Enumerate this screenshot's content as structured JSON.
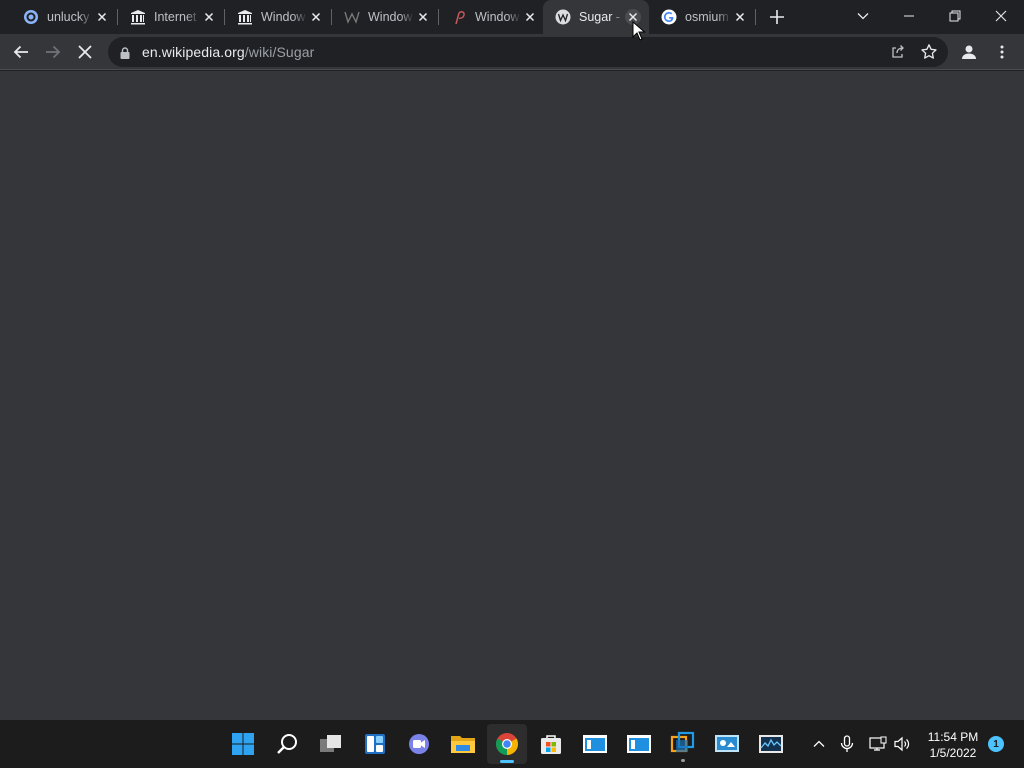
{
  "browser": {
    "tabs": [
      {
        "title": "unlucky",
        "favicon": "generic-page-icon",
        "active": false
      },
      {
        "title": "Internet",
        "favicon": "museum-columns-icon",
        "active": false
      },
      {
        "title": "Window",
        "favicon": "museum-columns-icon",
        "active": false
      },
      {
        "title": "Window",
        "favicon": "wiktionary-w-icon",
        "active": false
      },
      {
        "title": "Window",
        "favicon": "pinterest-like-icon",
        "active": false
      },
      {
        "title": "Sugar -",
        "favicon": "wikipedia-w-icon",
        "active": true
      },
      {
        "title": "osmium",
        "favicon": "google-g-icon",
        "active": false
      }
    ],
    "address": {
      "host": "en.wikipedia.org",
      "path": "/wiki/Sugar"
    },
    "state": "loading"
  },
  "taskbar": {
    "apps": [
      {
        "name": "start-button",
        "icon": "windows-logo-icon"
      },
      {
        "name": "search-button",
        "icon": "search-icon"
      },
      {
        "name": "task-view-button",
        "icon": "task-view-icon"
      },
      {
        "name": "widgets-button",
        "icon": "widgets-icon"
      },
      {
        "name": "chat-button",
        "icon": "teams-chat-icon"
      },
      {
        "name": "file-explorer-button",
        "icon": "folder-icon"
      },
      {
        "name": "chrome-button",
        "icon": "chrome-icon",
        "active": true
      },
      {
        "name": "store-button",
        "icon": "store-icon"
      },
      {
        "name": "app-button-1",
        "icon": "app-window-icon"
      },
      {
        "name": "app-button-2",
        "icon": "app-window-icon"
      },
      {
        "name": "app-button-3",
        "icon": "vm-icon"
      },
      {
        "name": "app-button-4",
        "icon": "control-panel-icon"
      },
      {
        "name": "app-button-5",
        "icon": "resource-monitor-icon"
      }
    ],
    "clock": {
      "time": "11:54 PM",
      "date": "1/5/2022"
    },
    "notification_count": "1"
  },
  "colors": {
    "tab_strip": "#202124",
    "toolbar": "#35363a",
    "omnibox": "#202124",
    "content": "#35363a",
    "taskbar": "#1c1c1c",
    "accent": "#4cc2ff"
  }
}
